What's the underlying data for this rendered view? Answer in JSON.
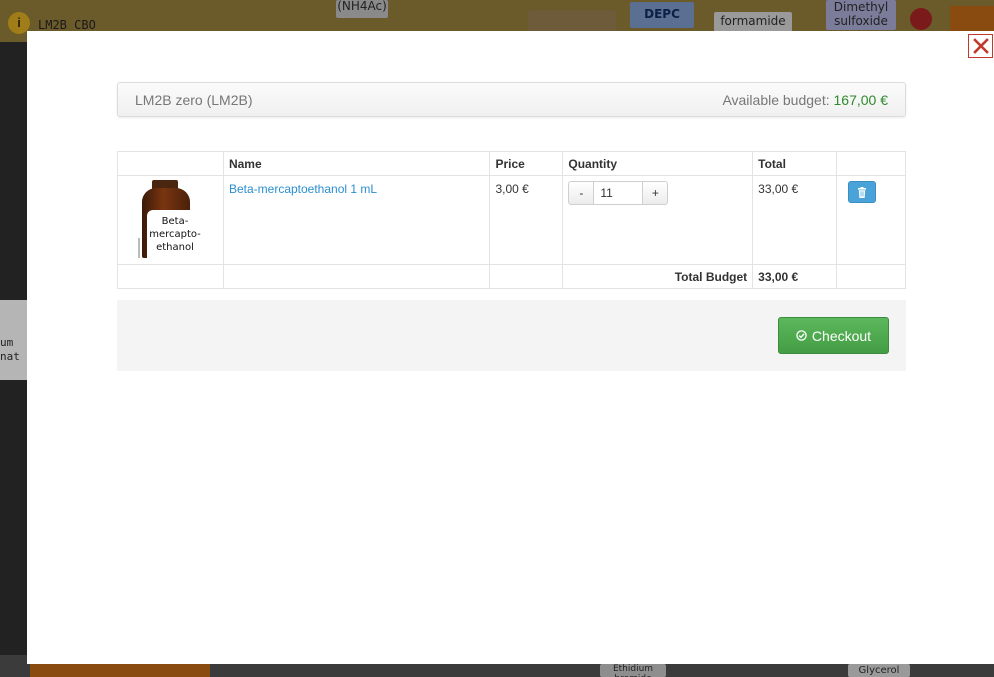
{
  "background": {
    "top_label": "LM2B CBO",
    "top_shelf_items": [
      "(NH4Ac)",
      "DEPC",
      "formamide",
      "Dimethyl sulfoxide"
    ],
    "left_side_texts": [
      "um",
      "nat"
    ],
    "bottom_shelf_items": [
      "Ethidium bromide",
      "Glycerol"
    ]
  },
  "modal": {
    "close_label": "Close",
    "account_name": "LM2B zero (LM2B)",
    "budget_label": "Available budget:",
    "budget_value": "167,00 €",
    "table": {
      "headers": [
        "",
        "Name",
        "Price",
        "Quantity",
        "Total",
        ""
      ],
      "items": [
        {
          "image_label": "Beta-\nmercapto-\nethanol",
          "name": "Beta-mercaptoethanol 1 mL",
          "price": "3,00 €",
          "quantity": "11",
          "total": "33,00 €"
        }
      ],
      "qty_minus": "-",
      "qty_plus": "+",
      "total_label": "Total Budget",
      "total_value": "33,00 €"
    },
    "checkout_label": "Checkout"
  },
  "colors": {
    "link": "#2a8fd0",
    "budget_green": "#2e8b2e",
    "checkout_green": "#5cb85c",
    "delete_blue": "#4aa3d8",
    "close_red": "#c0392b"
  },
  "icons": {
    "close": "close-x-icon",
    "delete": "trash-icon",
    "checkout": "checkout-check-icon"
  }
}
